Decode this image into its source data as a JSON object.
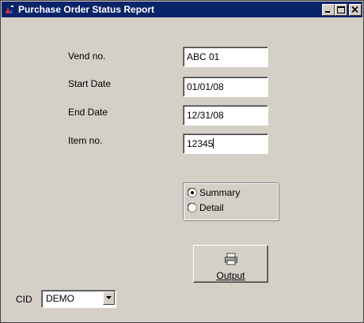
{
  "window": {
    "title": "Purchase Order Status Report"
  },
  "form": {
    "vend_label": "Vend no.",
    "vend_value": "ABC 01",
    "start_label": "Start Date",
    "start_value": "01/01/08",
    "end_label": "End Date",
    "end_value": "12/31/08",
    "item_label": "Item no.",
    "item_value": "12345"
  },
  "report_type": {
    "options": [
      {
        "label": "Summary",
        "selected": true
      },
      {
        "label": "Detail",
        "selected": false
      }
    ]
  },
  "output_button": {
    "label": "Output",
    "icon": "printer-icon"
  },
  "cid": {
    "label": "CID",
    "selected": "DEMO"
  },
  "colors": {
    "titlebar": "#0a246a",
    "face": "#d4d0c8"
  }
}
